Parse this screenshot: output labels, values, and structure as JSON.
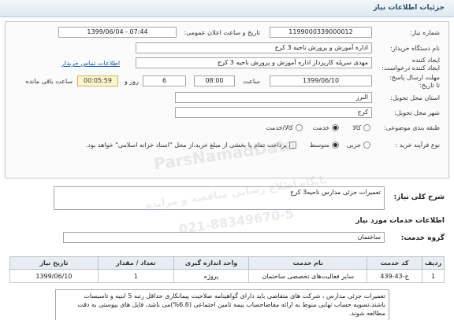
{
  "header": {
    "title": "جزئیات اطلاعات نیاز"
  },
  "need_info": {
    "need_number_label": "شماره نیاز:",
    "need_number": "1199000339000012",
    "announce_label": "تاریخ و ساعت اعلان عمومی:",
    "announce_value": "1399/06/04 - 07:44",
    "buyer_label": "نام دستگاه خریدار:",
    "buyer_value": "اداره آموزش و پرورش ناحیه 3 کرج",
    "creator_label": "ایجاد کننده درخواست:",
    "creator_value": "مهدی سرپله کارپرداز اداره آموزش و پرورش ناحیه 3 کرج",
    "contact_link": "اطلاعات تماس خریدار",
    "deadline_label": "مهلت ارسال پاسخ: تا تاریخ:",
    "deadline_date": "1399/06/10",
    "time_label": "ساعت",
    "deadline_time": "08:00",
    "days_value": "6",
    "days_label": "روز و",
    "remaining_time": "00:05:59",
    "remaining_label": "ساعت باقی مانده",
    "province_label": "استان محل تحویل:",
    "province_value": "البرز",
    "city_label": "شهر محل تحویل:",
    "city_value": "کرج",
    "category_label": "طبقه بندی موضوعی:",
    "category_options": [
      "کالا",
      "خدمت",
      "کالا/خدمت"
    ],
    "category_selected": "خدمت",
    "process_label": "نوع فرآیند خرید :",
    "process_options": [
      "جزیی",
      "متوسط"
    ],
    "process_selected": "متوسط",
    "payment_note": "پرداخت تمام یا بخشی از مبلغ خرید،از محل \"اسناد خزانه اسلامی\" خواهد بود."
  },
  "description": {
    "label": "شرح کلی نیاز:",
    "value": "تعمیرات جزئی مدارس ناحیه3 کرج"
  },
  "services": {
    "section_title": "اطلاعات خدمات مورد نیاز",
    "group_label": "گروه خدمت:",
    "group_value": "ساختمان",
    "table": {
      "headers": [
        "ردیف",
        "کد خدمت",
        "نام خدمت",
        "واحد اندازه گیری",
        "تعداد / مقدار",
        "تاریخ نیاز"
      ],
      "rows": [
        [
          "1",
          "ج-43-439",
          "سایر فعالیت‌های تخصصی ساختمان",
          "پروژه",
          "1",
          "1399/06/10"
        ]
      ]
    }
  },
  "notes": {
    "text": "تعمیرات جزئی مدارس ، شرکت های متقاضی باید دارای گواهینامه صلاحیت پیمانکاری حداقل رتبه 5 ابنیه و تاسیسات باشند،تسویه حساب نهایی منوط به ارائه مفاصاحساب بیمه تامین اجتماعی (6.6%)می باشد، فایل های پیوستی به دقت مطالعه شوند."
  },
  "watermark": {
    "line1": "ParsNamadData",
    "line2": "پایگاه اطلاع رسانی مناقصه و مزایده",
    "line3": "021-88349670-5"
  }
}
